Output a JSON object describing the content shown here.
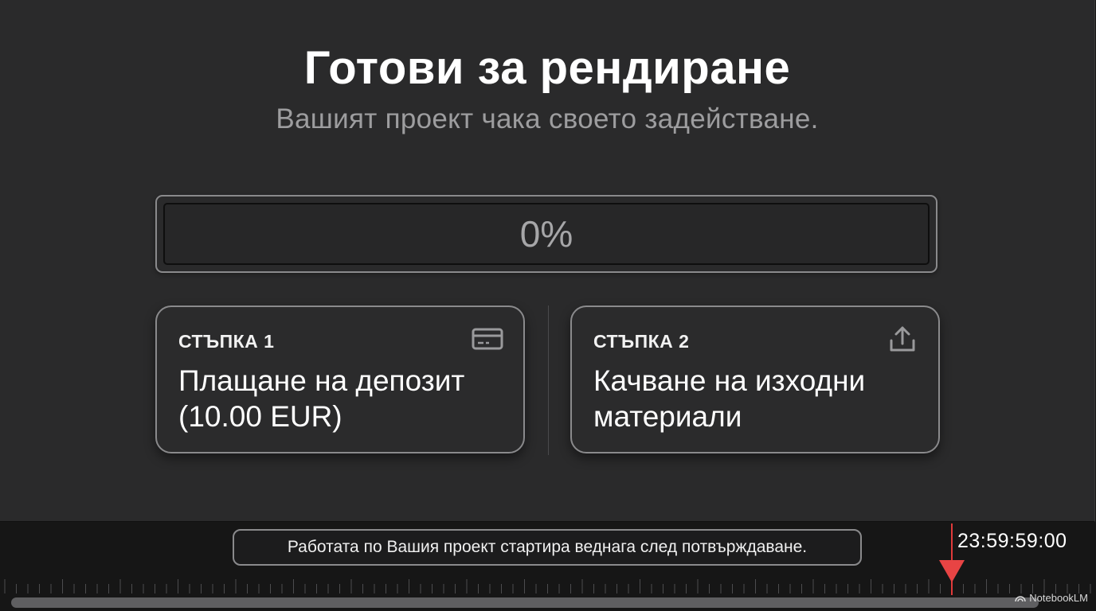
{
  "header": {
    "title": "Готови за рендиране",
    "subtitle": "Вашият проект чака своето задействане."
  },
  "progress": {
    "label": "0%",
    "value": 0
  },
  "steps": [
    {
      "step_label": "СТЪПКА 1",
      "text": "Плащане на депозит (10.00 EUR)",
      "icon": "credit-card-icon"
    },
    {
      "step_label": "СТЪПКА 2",
      "text": "Качване на изходни материали",
      "icon": "upload-icon"
    }
  ],
  "timeline": {
    "notice": "Работата по Вашия проект стартира веднага след потвърждаване.",
    "timecode": "23:59:59:00",
    "playhead_color": "#e84444"
  },
  "brand": {
    "label": "NotebookLM"
  }
}
